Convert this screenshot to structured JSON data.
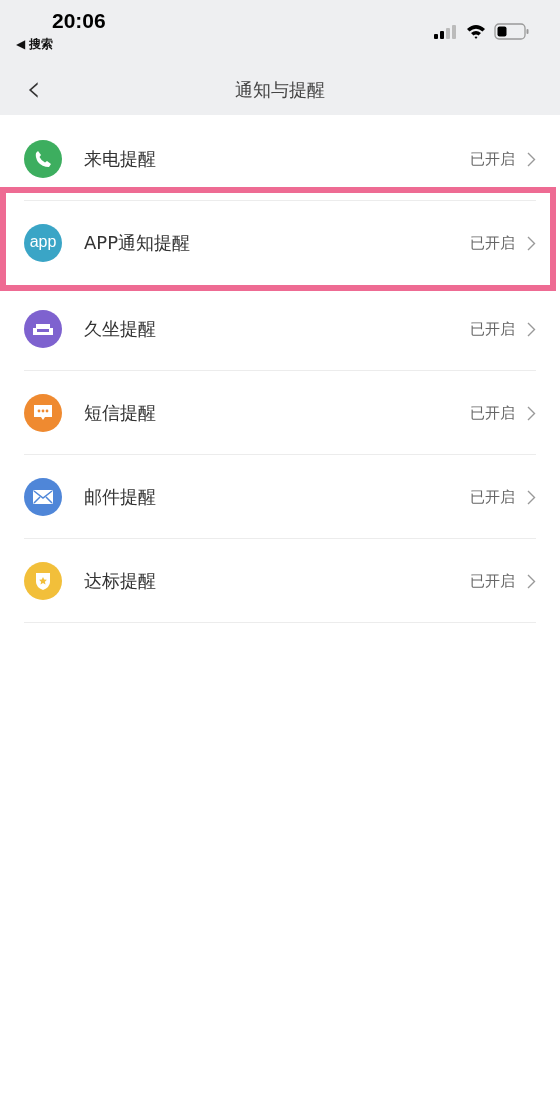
{
  "status_bar": {
    "time": "20:06",
    "back_label": "◀ 搜索"
  },
  "nav": {
    "back": "‹",
    "title": "通知与提醒"
  },
  "items": [
    {
      "label": "来电提醒",
      "status": "已开启",
      "kind": "phone",
      "color": "#3dae5f",
      "highlighted": false
    },
    {
      "label": "APP通知提醒",
      "status": "已开启",
      "kind": "app",
      "icon_text": "app",
      "color": "#3aa5c6",
      "highlighted": true
    },
    {
      "label": "久坐提醒",
      "status": "已开启",
      "kind": "sofa",
      "color": "#7e62cf",
      "highlighted": false
    },
    {
      "label": "短信提醒",
      "status": "已开启",
      "kind": "chat",
      "color": "#ef8a30",
      "highlighted": false
    },
    {
      "label": "邮件提醒",
      "status": "已开启",
      "kind": "mail",
      "color": "#4f86d8",
      "highlighted": false
    },
    {
      "label": "达标提醒",
      "status": "已开启",
      "kind": "badge",
      "color": "#f2bf3a",
      "highlighted": false
    }
  ]
}
